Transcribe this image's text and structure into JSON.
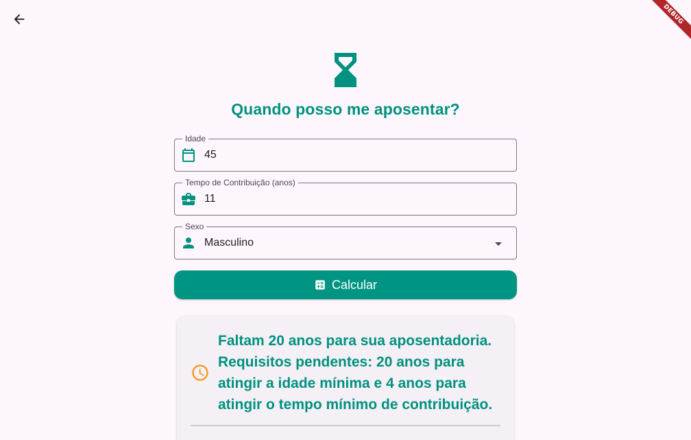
{
  "app": {
    "debug_banner": "DEBUG"
  },
  "header": {
    "title": "Quando posso me aposentar?"
  },
  "form": {
    "idade": {
      "label": "Idade",
      "value": "45",
      "icon": "calendar-icon"
    },
    "tempo_contribuicao": {
      "label": "Tempo de Contribuição (anos)",
      "value": "11",
      "icon": "briefcase-icon"
    },
    "sexo": {
      "label": "Sexo",
      "value": "Masculino",
      "icon": "person-icon"
    },
    "calculate_button": {
      "label": "Calcular",
      "icon": "calculator-icon"
    }
  },
  "result": {
    "icon": "clock-icon",
    "message": "Faltam 20 anos para sua aposentadoria. Requisitos pendentes: 20 anos para atingir a idade mínima e 4 anos para atingir o tempo mínimo de contribuição."
  },
  "colors": {
    "accent": "#009582",
    "title_text": "#00917f",
    "warning_icon": "#f29a1f",
    "background": "#fdf7fd"
  }
}
